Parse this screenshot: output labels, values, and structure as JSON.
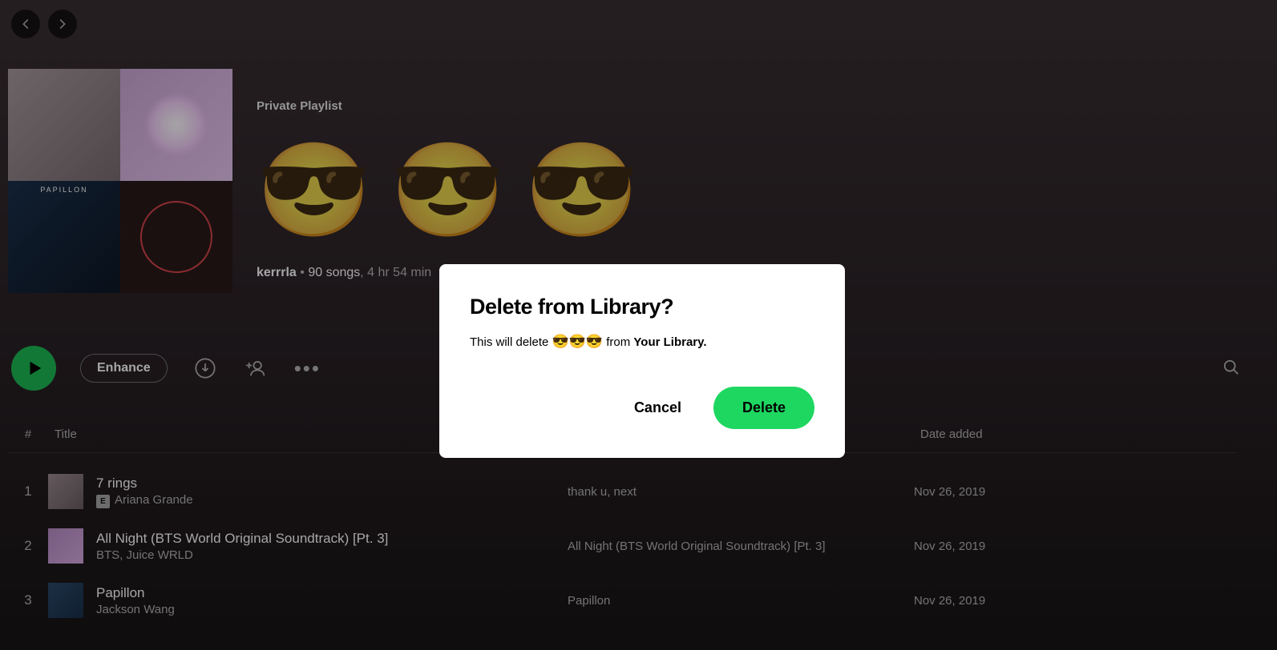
{
  "nav": {
    "back_label": "Back",
    "forward_label": "Forward"
  },
  "playlist": {
    "type": "Private Playlist",
    "title_emoji": "😎",
    "owner": "kerrrla",
    "sep1": " • ",
    "songs": "90 songs",
    "sep2": ", ",
    "duration": "4 hr 54 min"
  },
  "actions": {
    "enhance": "Enhance"
  },
  "columns": {
    "num": "#",
    "title": "Title",
    "date": "Date added"
  },
  "tracks": [
    {
      "num": "1",
      "name": "7 rings",
      "artist": "Ariana Grande",
      "explicit": true,
      "album": "thank u, next",
      "date": "Nov 26, 2019"
    },
    {
      "num": "2",
      "name": "All Night (BTS World Original Soundtrack) [Pt. 3]",
      "artist": "BTS, Juice WRLD",
      "explicit": false,
      "album": "All Night (BTS World Original Soundtrack) [Pt. 3]",
      "date": "Nov 26, 2019"
    },
    {
      "num": "3",
      "name": "Papillon",
      "artist": "Jackson Wang",
      "explicit": false,
      "album": "Papillon",
      "date": "Nov 26, 2019"
    }
  ],
  "modal": {
    "title": "Delete from Library?",
    "body_prefix": "This will delete ",
    "body_emoji": "😎😎😎",
    "body_middle": " from ",
    "body_strong": "Your Library.",
    "cancel": "Cancel",
    "delete": "Delete"
  }
}
